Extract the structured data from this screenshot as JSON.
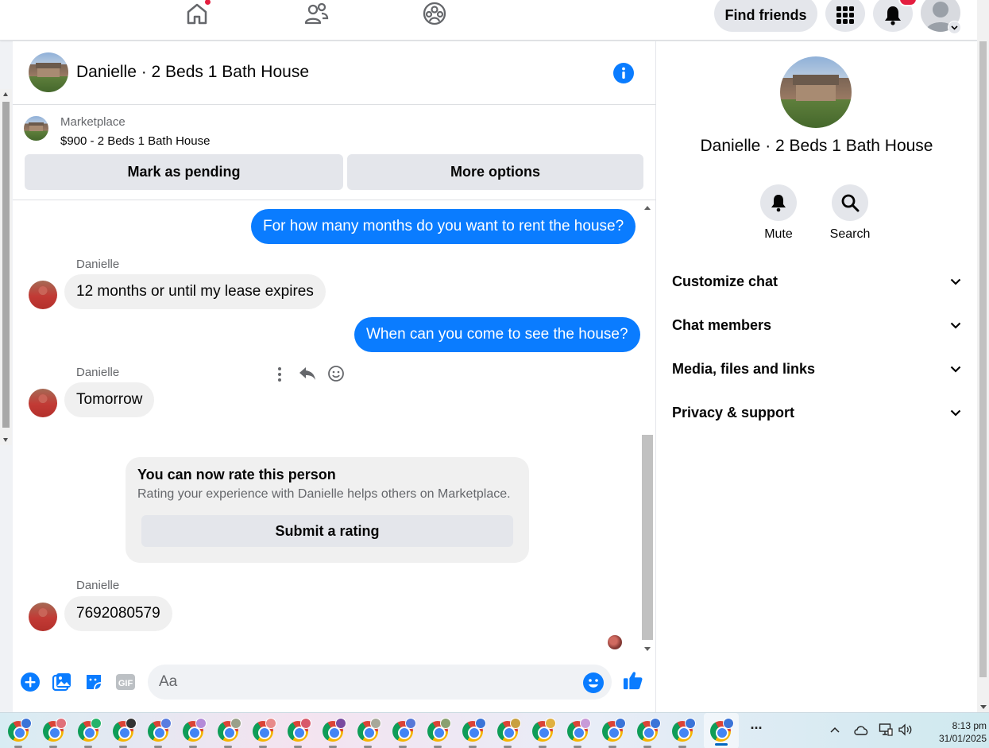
{
  "nav": {
    "find_friends": "Find friends"
  },
  "chat": {
    "title": "Danielle · 2 Beds 1 Bath House",
    "listing": {
      "label": "Marketplace",
      "price_title": "$900 - 2 Beds 1 Bath House",
      "mark_pending": "Mark as pending",
      "more_options": "More options"
    },
    "messages": [
      {
        "from": "me",
        "text": "For how many months do you want to rent the house?"
      },
      {
        "from": "Danielle",
        "sender": "Danielle",
        "text": "12 months or until my lease expires"
      },
      {
        "from": "me",
        "text": "When can you come to see the house?"
      },
      {
        "from": "Danielle",
        "sender": "Danielle",
        "text": "Tomorrow"
      },
      {
        "from": "Danielle",
        "sender": "Danielle",
        "text": "7692080579"
      }
    ],
    "rating": {
      "title": "You can now rate this person",
      "subtitle": "Rating your experience with Danielle helps others on Marketplace.",
      "button": "Submit a rating"
    },
    "composer": {
      "placeholder": "Aa"
    }
  },
  "right_panel": {
    "title": "Danielle · 2 Beds 1 Bath House",
    "actions": [
      {
        "label": "Mute",
        "icon": "bell-icon"
      },
      {
        "label": "Search",
        "icon": "search-icon"
      }
    ],
    "sections": [
      {
        "label": "Customize chat"
      },
      {
        "label": "Chat members"
      },
      {
        "label": "Media, files and links"
      },
      {
        "label": "Privacy & support"
      }
    ]
  },
  "taskbar": {
    "time": "8:13 pm",
    "date": "31/01/2025",
    "more": "···"
  },
  "colors": {
    "accent": "#0a7cff",
    "badge": "#e41e3f",
    "button_bg": "#e4e6eb"
  }
}
